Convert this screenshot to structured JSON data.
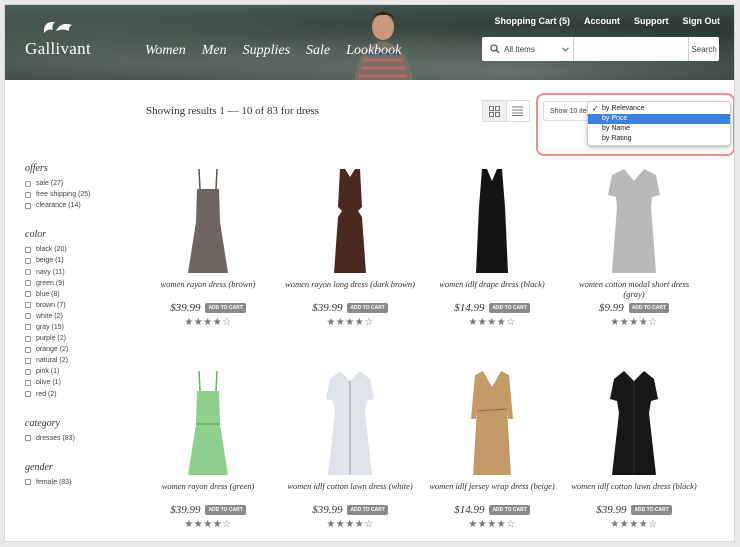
{
  "brand": {
    "name": "Gallivant"
  },
  "nav": [
    "Women",
    "Men",
    "Supplies",
    "Sale",
    "Lookbook"
  ],
  "top_links": [
    "Shopping Cart (5)",
    "Account",
    "Support",
    "Sign Out"
  ],
  "search": {
    "scope": "All Items",
    "placeholder": "",
    "button": "Search"
  },
  "results_text": "Showing results 1 — 10 of 83 for dress",
  "show_select": "Show 10 items",
  "sort_options": [
    {
      "label": "by Relevance",
      "checked": true,
      "highlighted": false
    },
    {
      "label": "by Price",
      "checked": false,
      "highlighted": true
    },
    {
      "label": "by Name",
      "checked": false,
      "highlighted": false
    },
    {
      "label": "by Rating",
      "checked": false,
      "highlighted": false
    }
  ],
  "facets": [
    {
      "title": "offers",
      "options": [
        "sale (27)",
        "free shipping (25)",
        "clearance (14)"
      ]
    },
    {
      "title": "color",
      "options": [
        "black (20)",
        "beige (1)",
        "navy (11)",
        "green (9)",
        "blue (8)",
        "brown (7)",
        "white (2)",
        "gray (15)",
        "purple (2)",
        "orange (2)",
        "natural (2)",
        "pink (1)",
        "olive (1)",
        "red (2)"
      ]
    },
    {
      "title": "category",
      "options": [
        "dresses (83)"
      ]
    },
    {
      "title": "gender",
      "options": [
        "female (83)"
      ]
    }
  ],
  "products": [
    {
      "name": "women rayon dress (brown)",
      "price": "$39.99",
      "button": "ADD TO CART",
      "rating": 4,
      "color": "#6e6460"
    },
    {
      "name": "women rayon long dress (dark brown)",
      "price": "$39.99",
      "button": "ADD TO CART",
      "rating": 4,
      "color": "#4a2a20"
    },
    {
      "name": "women idlf drape dress (black)",
      "price": "$14.99",
      "button": "ADD TO CART",
      "rating": 4,
      "color": "#141414"
    },
    {
      "name": "women cotton modal short dress (gray)",
      "price": "$9.99",
      "button": "ADD TO CART",
      "rating": 4,
      "color": "#b9b9b7"
    },
    {
      "name": "women rayon dress (green)",
      "price": "$39.99",
      "button": "ADD TO CART",
      "rating": 4,
      "color": "#8fd08c"
    },
    {
      "name": "women idlf cotton lawn dress (white)",
      "price": "$39.99",
      "button": "ADD TO CART",
      "rating": 4,
      "color": "#dfe3ea"
    },
    {
      "name": "women idlf jersey wrap dress (beige)",
      "price": "$14.99",
      "button": "ADD TO CART",
      "rating": 4,
      "color": "#c49a68"
    },
    {
      "name": "women idlf cotton lawn dress (black)",
      "price": "$39.99",
      "button": "ADD TO CART",
      "rating": 4,
      "color": "#171717"
    }
  ]
}
